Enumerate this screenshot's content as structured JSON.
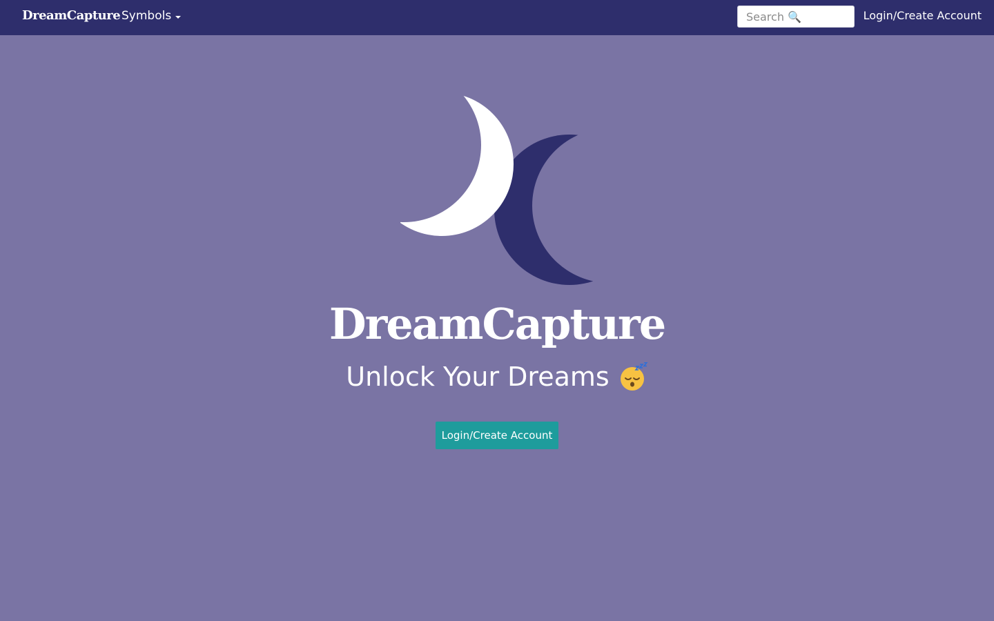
{
  "navbar": {
    "brand": "DreamCapture",
    "symbols_label": "Symbols",
    "search_placeholder": "Search 🔍",
    "login_label": "Login/Create Account"
  },
  "hero": {
    "title": "DreamCapture",
    "tagline": "Unlock Your Dreams",
    "cta_label": "Login/Create Account"
  },
  "icons": {
    "logo": "two-crescent-moons-logo",
    "tagline_emoji": "sleeping-face-emoji",
    "symbols_caret": "caret-down-icon"
  },
  "colors": {
    "page_background": "#7a74a4",
    "navbar_background": "#2e2e6c",
    "moon_light": "#ffffff",
    "moon_dark": "#2e2e6c",
    "cta_background": "#1e9c9c"
  }
}
